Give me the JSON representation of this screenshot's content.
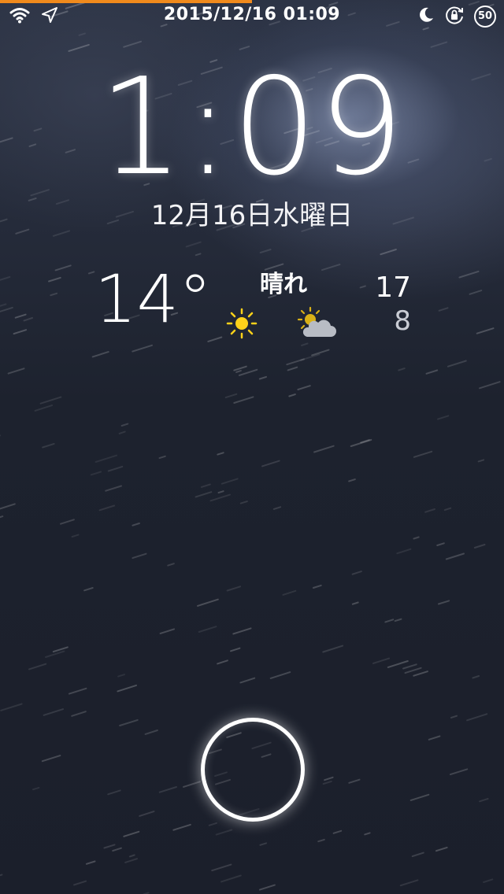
{
  "status_bar": {
    "datetime": "2015/12/16 01:09",
    "battery": "50",
    "icons": [
      "wifi-icon",
      "location-arrow-icon",
      "moon-icon",
      "rotation-lock-icon"
    ]
  },
  "progress": {
    "fraction": 0.5,
    "color": "#f08a1c"
  },
  "lock_screen": {
    "time": "1:09",
    "date": "12月16日水曜日"
  },
  "weather": {
    "current_temp": "14°",
    "condition": "晴れ",
    "forecast_icons": [
      "sun-icon",
      "sun-behind-cloud-icon"
    ],
    "high": "17",
    "low": "8"
  },
  "colors": {
    "accent": "#f08a1c",
    "sun": "#ffd21a",
    "background": "#1b202b"
  }
}
